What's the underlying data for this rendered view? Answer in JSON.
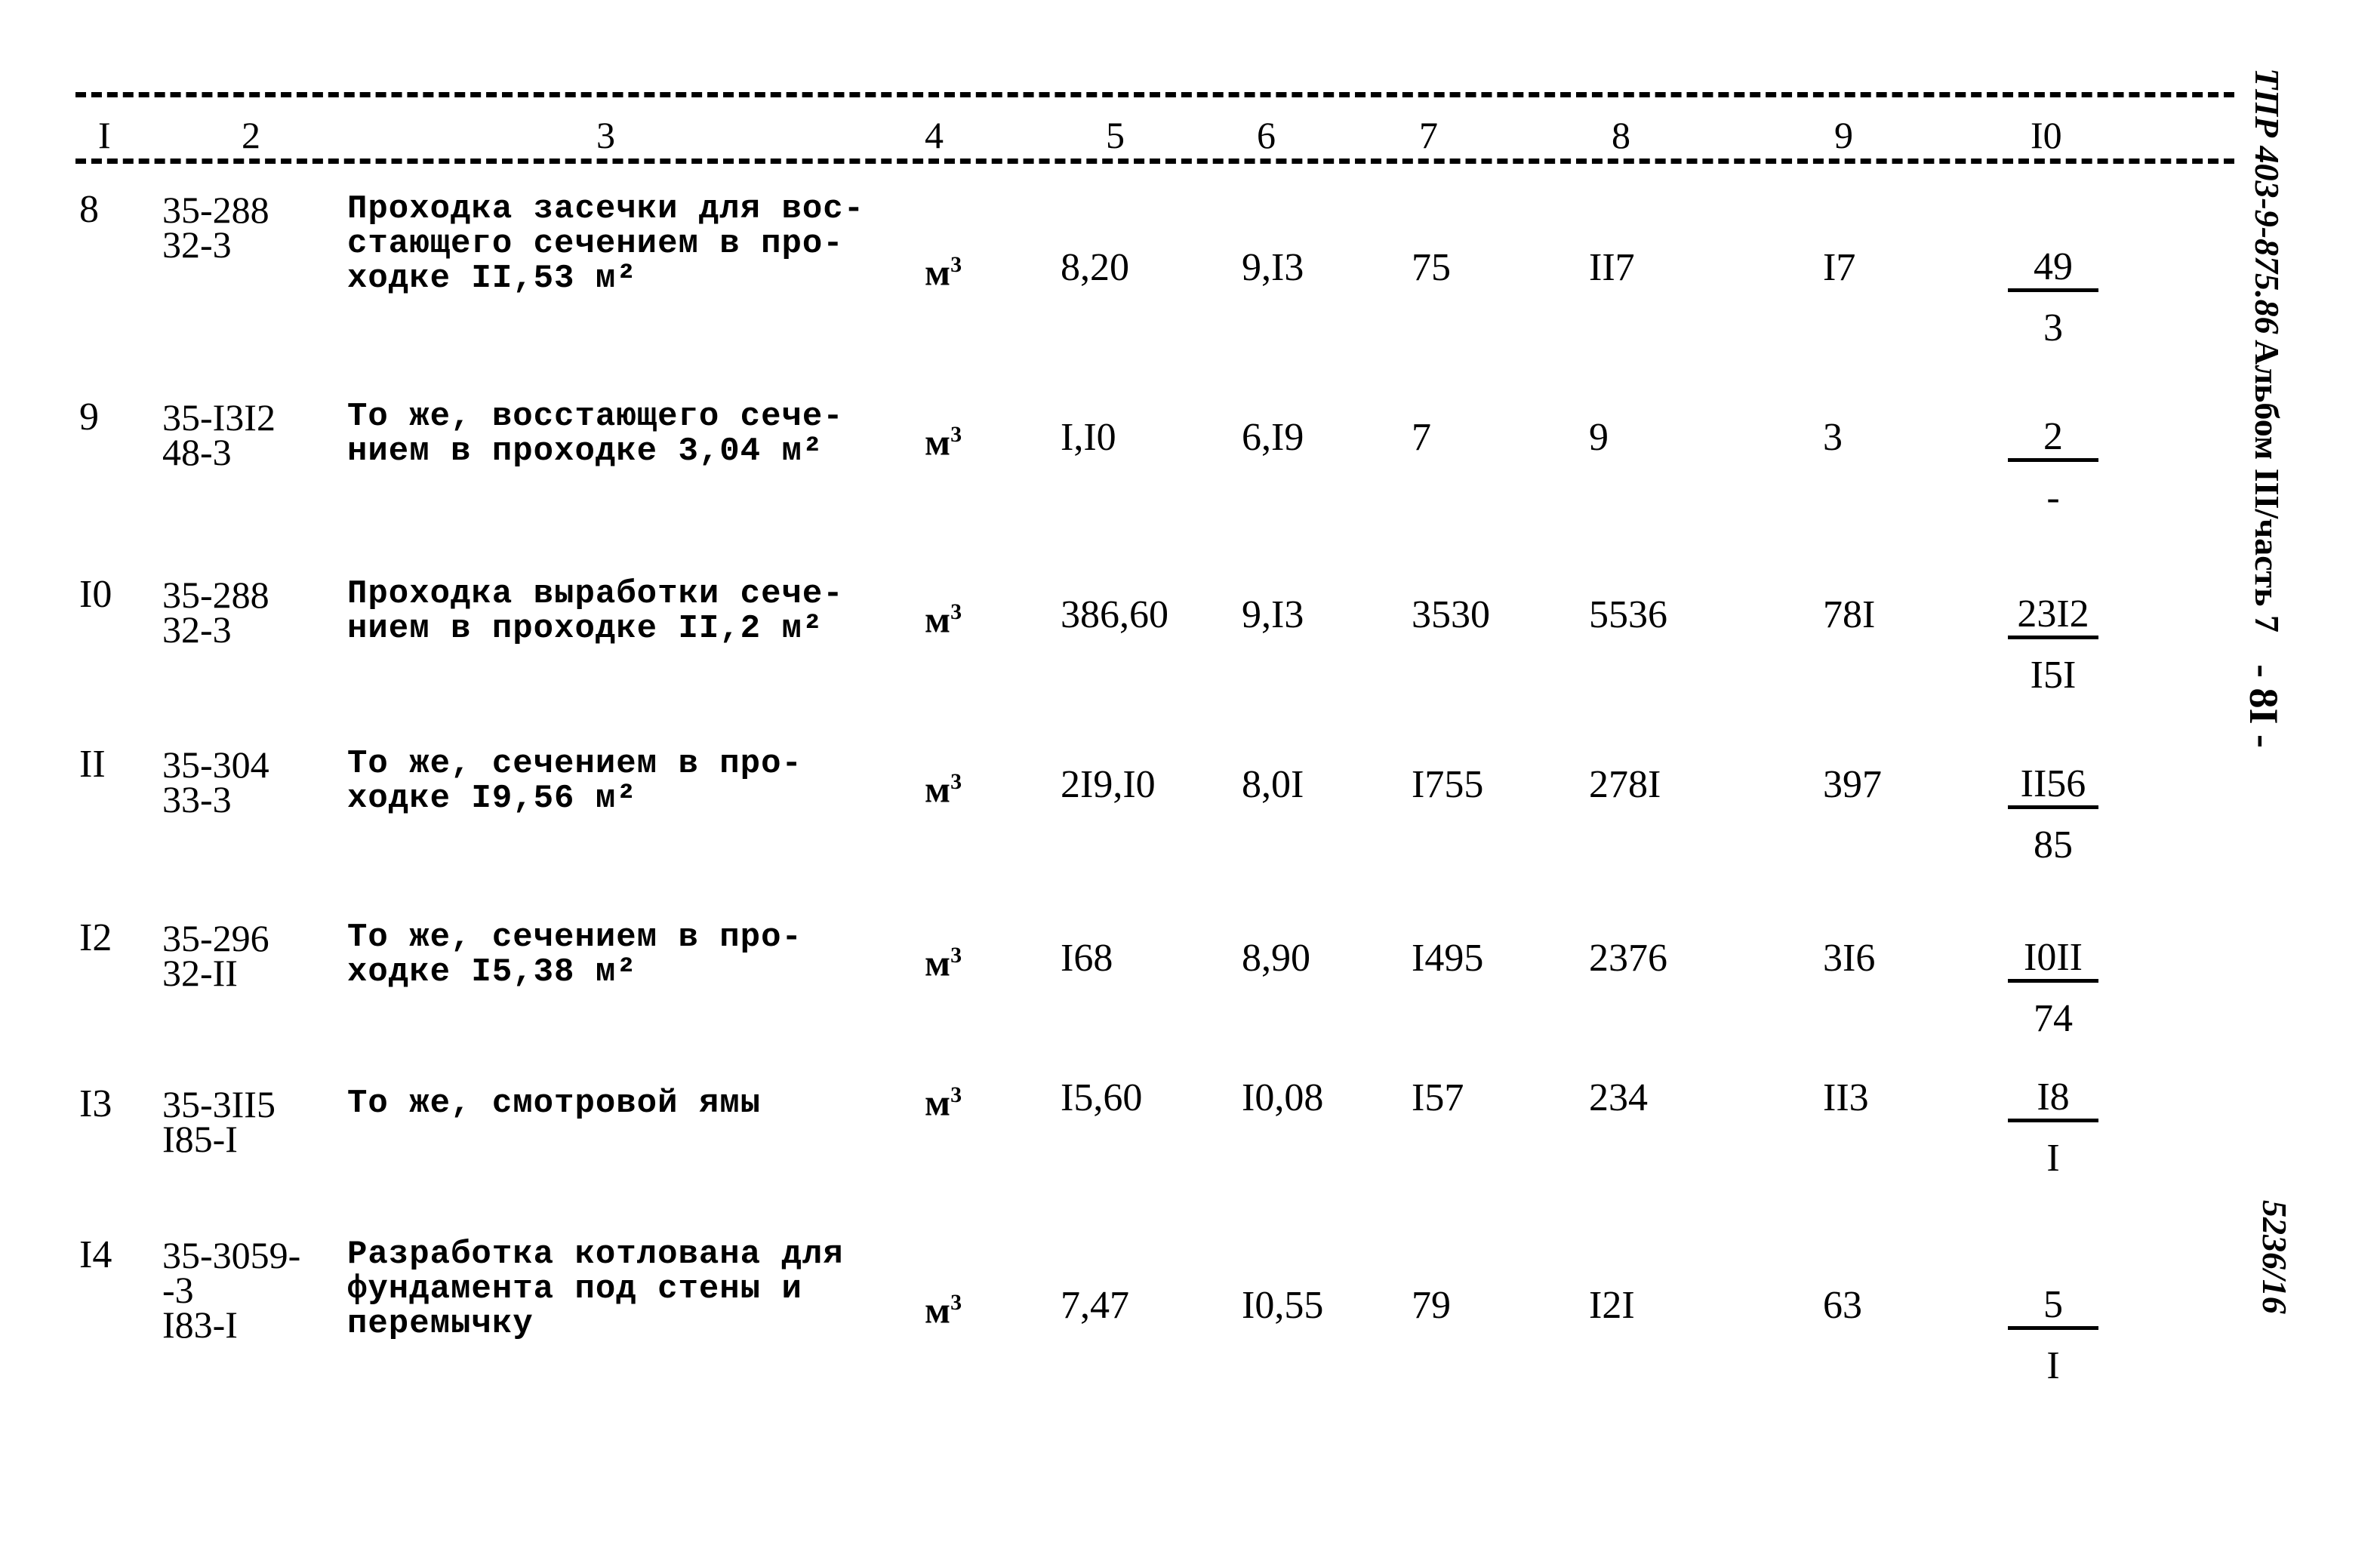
{
  "header": {
    "columns": [
      "I",
      "2",
      "3",
      "4",
      "5",
      "6",
      "7",
      "8",
      "9",
      "I0"
    ]
  },
  "rows": [
    {
      "no": "8",
      "code": [
        "35-288",
        "32-3"
      ],
      "description": [
        "Проходка засечки для вос-",
        "стающего сечением в про-",
        "ходке II,53 м²"
      ],
      "unit": "м",
      "unit_sup": "3",
      "c5": "8,20",
      "c6": "9,I3",
      "c7": "75",
      "c8": "II7",
      "c9": "I7",
      "c10_top": "49",
      "c10_bottom": "3"
    },
    {
      "no": "9",
      "code": [
        "35-I3I2",
        "48-3"
      ],
      "description": [
        "То же, восстающего сече-",
        "нием в проходке 3,04 м²"
      ],
      "unit": "м",
      "unit_sup": "3",
      "c5": "I,I0",
      "c6": "6,I9",
      "c7": "7",
      "c8": "9",
      "c9": "3",
      "c10_top": "2",
      "c10_bottom": "-"
    },
    {
      "no": "I0",
      "code": [
        "35-288",
        "32-3"
      ],
      "description": [
        "Проходка выработки сече-",
        "нием в проходке II,2 м²"
      ],
      "unit": "м",
      "unit_sup": "3",
      "c5": "386,60",
      "c6": "9,I3",
      "c7": "3530",
      "c8": "5536",
      "c9": "78I",
      "c10_top": "23I2",
      "c10_bottom": "I5I"
    },
    {
      "no": "II",
      "code": [
        "35-304",
        "33-3"
      ],
      "description": [
        "То же, сечением в про-",
        "ходке I9,56 м²"
      ],
      "unit": "м",
      "unit_sup": "3",
      "c5": "2I9,I0",
      "c6": "8,0I",
      "c7": "I755",
      "c8": "278I",
      "c9": "397",
      "c10_top": "II56",
      "c10_bottom": "85"
    },
    {
      "no": "I2",
      "code": [
        "35-296",
        "32-II"
      ],
      "description": [
        "То же, сечением в про-",
        "ходке I5,38 м²"
      ],
      "unit": "м",
      "unit_sup": "3",
      "c5": "I68",
      "c6": "8,90",
      "c7": "I495",
      "c8": "2376",
      "c9": "3I6",
      "c10_top": "I0II",
      "c10_bottom": "74"
    },
    {
      "no": "I3",
      "code": [
        "35-3II5",
        "I85-I"
      ],
      "description": [
        "То же, смотровой ямы"
      ],
      "unit": "м",
      "unit_sup": "3",
      "c5": "I5,60",
      "c6": "I0,08",
      "c7": "I57",
      "c8": "234",
      "c9": "II3",
      "c10_top": "I8",
      "c10_bottom": "I"
    },
    {
      "no": "I4",
      "code": [
        "35-3059-",
        "-3",
        "I83-I"
      ],
      "description": [
        "Разработка котлована для",
        "фундамента под стены и",
        "перемычку"
      ],
      "unit": "м",
      "unit_sup": "3",
      "c5": "7,47",
      "c6": "I0,55",
      "c7": "79",
      "c8": "I2I",
      "c9": "63",
      "c10_top": "5",
      "c10_bottom": "I"
    }
  ],
  "margin": {
    "doc_code": "ТПР 403-9-875.86",
    "album": "Альбом III/часть 7",
    "page": "- 8I -",
    "stamp": "5236/16"
  }
}
